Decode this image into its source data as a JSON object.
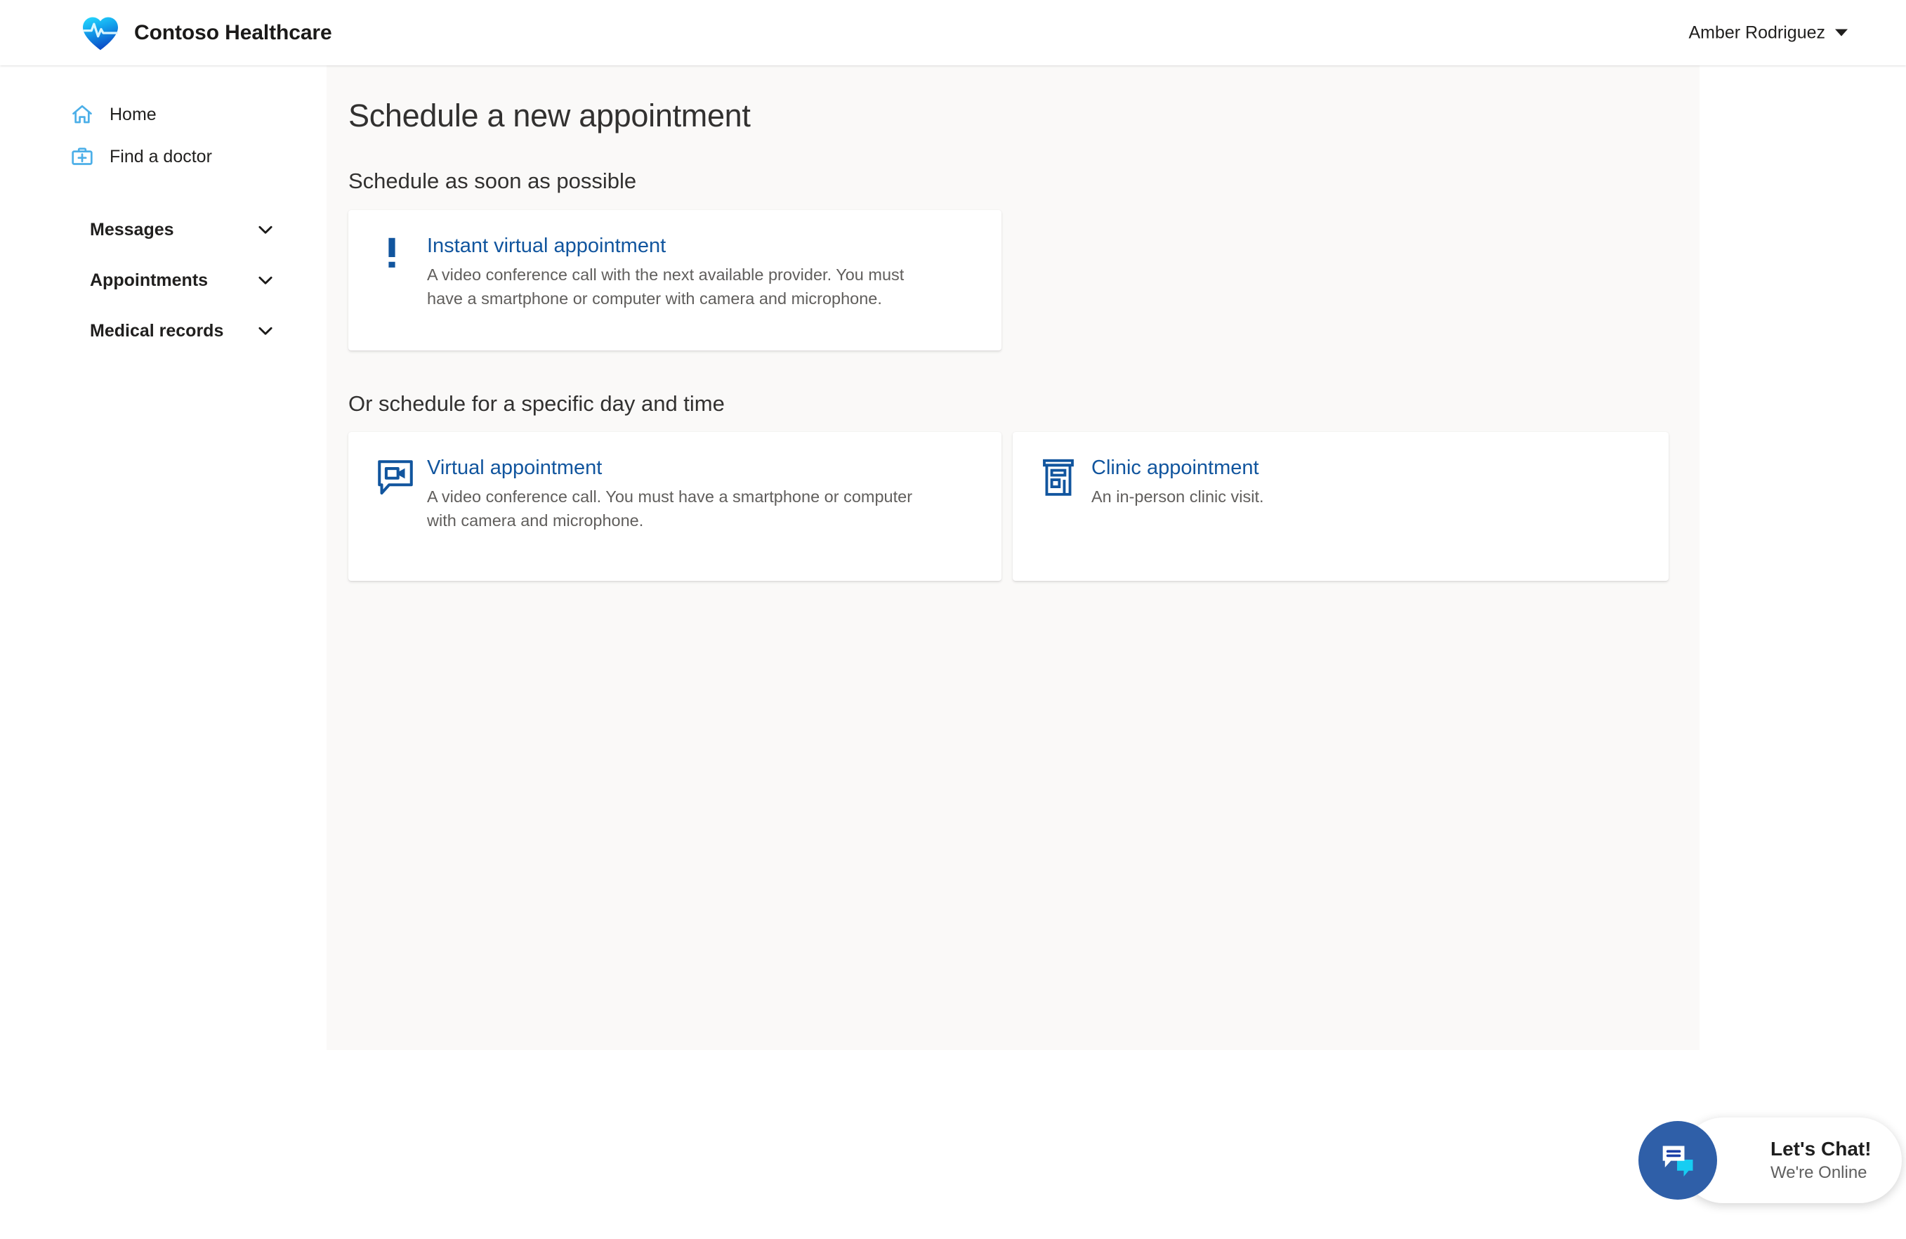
{
  "header": {
    "brand_name": "Contoso Healthcare",
    "logo_icon": "heart-pulse-logo",
    "user_name": "Amber Rodriguez",
    "user_caret_icon": "caret-down-icon"
  },
  "sidebar": {
    "links": [
      {
        "label": "Home",
        "icon": "home-icon"
      },
      {
        "label": "Find a doctor",
        "icon": "medical-bag-icon"
      }
    ],
    "groups": [
      {
        "label": "Messages",
        "icon": "chevron-down-icon"
      },
      {
        "label": "Appointments",
        "icon": "chevron-down-icon"
      },
      {
        "label": "Medical records",
        "icon": "chevron-down-icon"
      }
    ]
  },
  "main": {
    "page_title": "Schedule a new appointment",
    "section_one": {
      "title": "Schedule as soon as possible",
      "cards": [
        {
          "title": "Instant virtual appointment",
          "description": "A video conference call with the next available provider. You must have a smartphone or computer with camera and microphone.",
          "icon": "exclamation-icon"
        }
      ]
    },
    "section_two": {
      "title": "Or schedule for a specific day and time",
      "cards": [
        {
          "title": "Virtual appointment",
          "description": "A video conference call. You must have a smartphone or computer with camera and microphone.",
          "icon": "video-chat-icon"
        },
        {
          "title": "Clinic appointment",
          "description": "An in-person clinic visit.",
          "icon": "clinic-building-icon"
        }
      ]
    }
  },
  "chat_widget": {
    "title": "Let's Chat!",
    "status": "We're Online",
    "icon": "chat-bubbles-icon"
  },
  "colors": {
    "brand_blue": "#11559e",
    "link_blue": "#11559e",
    "icon_light_blue": "#4cafe8",
    "content_bg": "#faf9f8",
    "chat_circle": "#2f5fa8",
    "chat_bubble_cyan": "#16cdf2",
    "text_primary": "#323130",
    "text_secondary": "#605e5c"
  }
}
